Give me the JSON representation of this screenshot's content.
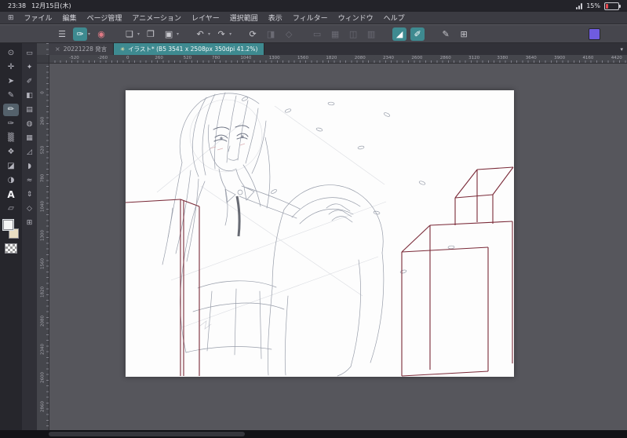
{
  "colors": {
    "accent_teal": "#3e8a90",
    "swatch_purple": "#6f5ce0",
    "perspective_red": "#7a2a38",
    "canvas_bg": "#56565c",
    "paper_white": "#fdfdfd",
    "battery_red": "#e5484f"
  },
  "status_bar": {
    "time": "23:38",
    "date": "12月15日(木)",
    "battery_percent": "15%"
  },
  "menu": {
    "workspace_icon": "⊞",
    "items": [
      {
        "id": "file",
        "label": "ファイル"
      },
      {
        "id": "edit",
        "label": "編集"
      },
      {
        "id": "page",
        "label": "ページ管理"
      },
      {
        "id": "animation",
        "label": "アニメーション"
      },
      {
        "id": "layer",
        "label": "レイヤー"
      },
      {
        "id": "selection",
        "label": "選択範囲"
      },
      {
        "id": "view",
        "label": "表示"
      },
      {
        "id": "filter",
        "label": "フィルター"
      },
      {
        "id": "window",
        "label": "ウィンドウ"
      },
      {
        "id": "help",
        "label": "ヘルプ"
      }
    ]
  },
  "toolbar": {
    "items": [
      {
        "id": "main-menu",
        "glyph": "☰",
        "state": "normal"
      },
      {
        "id": "current-tool",
        "glyph": "✑",
        "state": "selected",
        "chevron": true
      },
      {
        "id": "color-ring",
        "glyph": "◉",
        "state": "accent-pink"
      },
      {
        "id": "new-canvas",
        "glyph": "❏",
        "state": "normal",
        "chevron": true,
        "gap": true
      },
      {
        "id": "open-file",
        "glyph": "❐",
        "state": "normal"
      },
      {
        "id": "save-file",
        "glyph": "▣",
        "state": "normal",
        "chevron": true
      },
      {
        "id": "undo",
        "glyph": "↶",
        "state": "normal",
        "chevron": true,
        "gap": true
      },
      {
        "id": "redo",
        "glyph": "↷",
        "state": "normal",
        "chevron": true
      },
      {
        "id": "reset-view",
        "glyph": "⟳",
        "state": "normal",
        "gap": true
      },
      {
        "id": "transform",
        "glyph": "◨",
        "state": "disabled"
      },
      {
        "id": "mesh-transform",
        "glyph": "◇",
        "state": "disabled"
      },
      {
        "id": "select-area",
        "glyph": "▭",
        "state": "disabled",
        "gap": true
      },
      {
        "id": "deselect",
        "glyph": "▦",
        "state": "disabled"
      },
      {
        "id": "invert-selection",
        "glyph": "◫",
        "state": "disabled"
      },
      {
        "id": "selection-launcher",
        "glyph": "▥",
        "state": "disabled"
      },
      {
        "id": "snap-to-ruler",
        "glyph": "◢",
        "state": "selected",
        "gap": true
      },
      {
        "id": "snap-to-special-ruler",
        "glyph": "✐",
        "state": "selected"
      },
      {
        "id": "pen-settings",
        "glyph": "✎",
        "state": "normal",
        "gap": true
      },
      {
        "id": "grid",
        "glyph": "⊞",
        "state": "normal"
      },
      {
        "id": "color-swatch",
        "type": "swatch"
      }
    ]
  },
  "tabs": {
    "close_glyph": "×",
    "unsaved_glyph": "✳",
    "overflow_glyph": "▾",
    "items": [
      {
        "label": "20221228 発言",
        "active": false
      },
      {
        "label": "イラスト* (B5 3541 x 2508px 350dpi 41.2%)",
        "active": true
      }
    ]
  },
  "rulers": {
    "horizontal_labels": [
      -520,
      -260,
      0,
      260,
      520,
      780,
      1040,
      1300,
      1560,
      1820,
      2080,
      2340,
      2600,
      2860,
      3120,
      3380,
      3640,
      3900,
      4160,
      4420
    ],
    "vertical_labels": [
      0,
      260,
      520,
      780,
      1040,
      1300,
      1560,
      1820,
      2080,
      2340,
      2600,
      2860
    ]
  },
  "tools": {
    "foreground_color": "#f5f5f5",
    "background_color": "#e9ddc2",
    "column1": [
      {
        "id": "zoom",
        "glyph": "⊙"
      },
      {
        "id": "move",
        "glyph": "✛"
      },
      {
        "id": "operation",
        "glyph": "➤"
      },
      {
        "id": "pen",
        "glyph": "✎"
      },
      {
        "id": "pencil",
        "glyph": "✏",
        "selected": true
      },
      {
        "id": "brush",
        "glyph": "✑"
      },
      {
        "id": "airbrush",
        "glyph": "▒"
      },
      {
        "id": "decoration",
        "glyph": "❖"
      },
      {
        "id": "eraser",
        "glyph": "◪"
      },
      {
        "id": "blend",
        "glyph": "◑"
      },
      {
        "id": "text",
        "glyph": "A",
        "emphasis": true
      },
      {
        "id": "figure",
        "glyph": "▱"
      },
      {
        "type": "swatch-pair"
      },
      {
        "type": "checker"
      }
    ],
    "column2": [
      {
        "id": "marquee",
        "glyph": "▭"
      },
      {
        "id": "auto-select",
        "glyph": "✦"
      },
      {
        "id": "eyedropper",
        "glyph": "✐"
      },
      {
        "id": "fill",
        "glyph": "◧"
      },
      {
        "id": "gradient",
        "glyph": "▤"
      },
      {
        "id": "mix",
        "glyph": "◍"
      },
      {
        "id": "frame-border",
        "glyph": "▦"
      },
      {
        "id": "ruler-tool",
        "glyph": "◿"
      },
      {
        "id": "balloon",
        "glyph": "◗"
      },
      {
        "id": "line-correct",
        "glyph": "≈"
      },
      {
        "id": "layer-move",
        "glyph": "⇕"
      },
      {
        "id": "primitive",
        "glyph": "◇"
      },
      {
        "id": "sub-view",
        "glyph": "⊞"
      }
    ]
  }
}
